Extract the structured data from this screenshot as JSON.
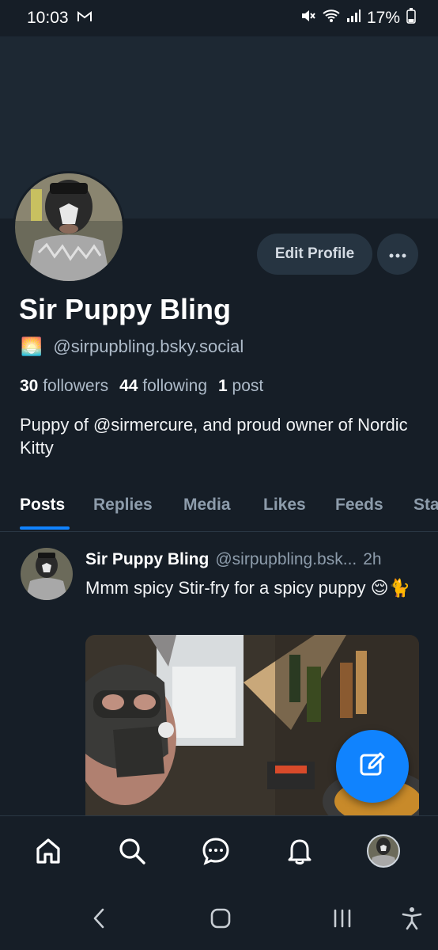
{
  "status_bar": {
    "time": "10:03",
    "battery": "17%"
  },
  "profile": {
    "display_name": "Sir Puppy Bling",
    "handle_emoji": "🌅",
    "handle": "@sirpupbling.bsky.social",
    "followers_count": "30",
    "followers_label": "followers",
    "following_count": "44",
    "following_label": "following",
    "posts_count": "1",
    "posts_label": "post",
    "bio": "Puppy of @sirmercure, and proud owner of Nordic Kitty",
    "edit_button": "Edit Profile"
  },
  "tabs": [
    {
      "label": "Posts",
      "active": true
    },
    {
      "label": "Replies",
      "active": false
    },
    {
      "label": "Media",
      "active": false
    },
    {
      "label": "Likes",
      "active": false
    },
    {
      "label": "Feeds",
      "active": false
    },
    {
      "label": "Starter Packs",
      "active": false
    }
  ],
  "post": {
    "author": "Sir Puppy Bling",
    "handle": "@sirpupbling.bsk...",
    "time": "2h",
    "text": "Mmm spicy Stir-fry for a spicy puppy 😌🐈"
  },
  "bottom_nav": [
    {
      "icon": "home-icon"
    },
    {
      "icon": "search-icon"
    },
    {
      "icon": "chat-icon"
    },
    {
      "icon": "bell-icon"
    },
    {
      "icon": "profile-avatar"
    }
  ],
  "colors": {
    "background": "#161e27",
    "banner": "#1d2833",
    "accent": "#1083fe",
    "muted_text": "#8d9cab",
    "button_bg": "#263441"
  }
}
